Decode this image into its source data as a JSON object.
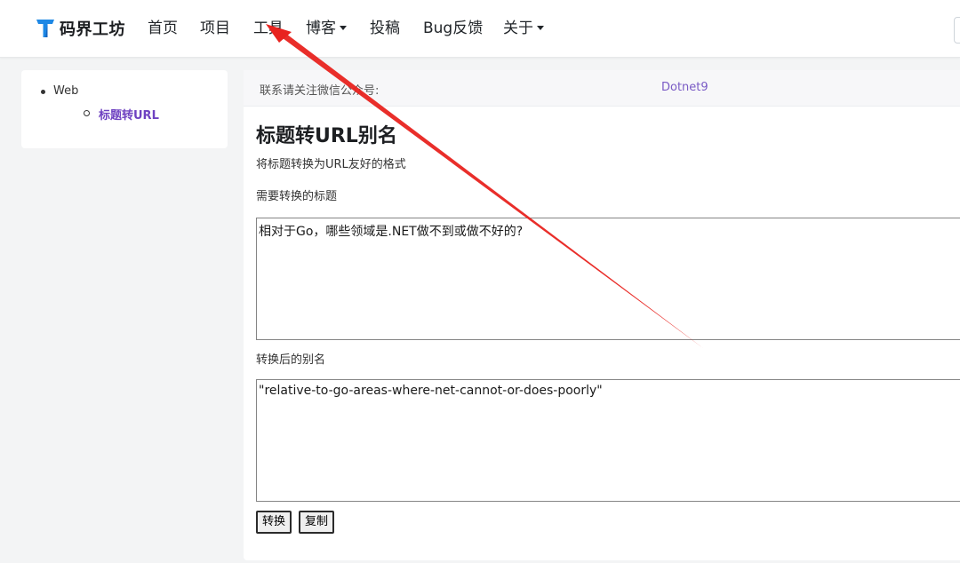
{
  "navbar": {
    "brand": "码界工坊",
    "items": [
      {
        "label": "首页"
      },
      {
        "label": "项目"
      },
      {
        "label": "工具"
      },
      {
        "label": "博客"
      },
      {
        "label": "投稿"
      },
      {
        "label": "Bug反馈"
      },
      {
        "label": "关于"
      }
    ]
  },
  "sidebar": {
    "category": "Web",
    "tool": "标题转URL"
  },
  "notice": {
    "label": "联系请关注微信公众号:",
    "value": "Dotnet9"
  },
  "main": {
    "title": "标题转URL别名",
    "description": "将标题转换为URL友好的格式",
    "input_label": "需要转换的标题",
    "input_value": "相对于Go，哪些领域是.NET做不到或做不好的?",
    "output_label": "转换后的别名",
    "output_value": "\"relative-to-go-areas-where-net-cannot-or-does-poorly\"",
    "convert_button": "转换",
    "copy_button": "复制"
  },
  "colors": {
    "accent": "#6f42c1",
    "annotation_arrow": "#e8231f",
    "brand_logo": "#1e88e5"
  },
  "icons": {
    "brand": "brand-t-logo-icon",
    "dropdown": "caret-down-icon",
    "annotation": "arrow-annotation-icon"
  }
}
